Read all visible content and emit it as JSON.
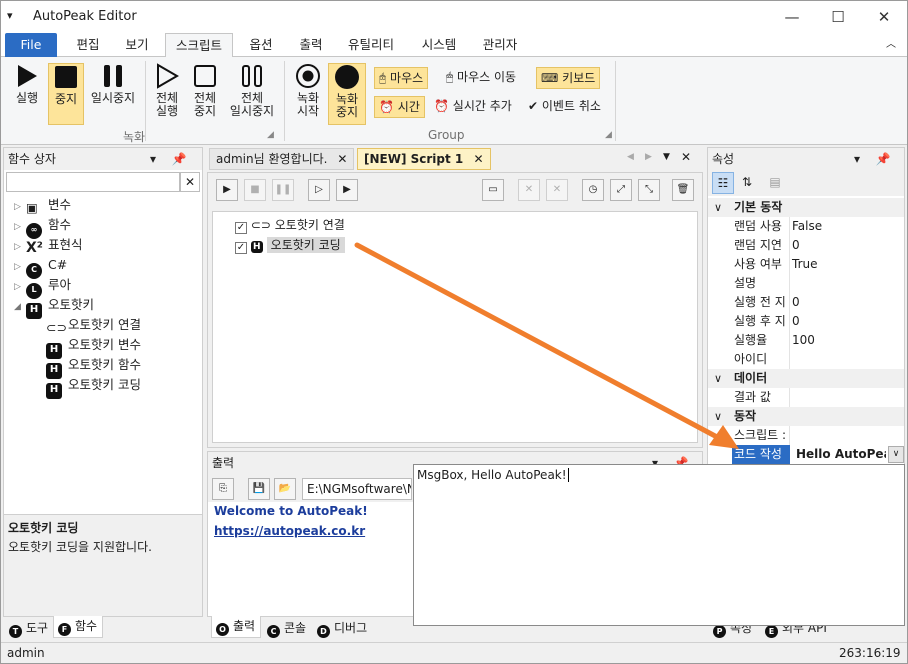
{
  "window": {
    "title": "AutoPeak Editor",
    "app_menu_icon": "menu-icon",
    "minimize": "—",
    "maximize": "☐",
    "close": "✕"
  },
  "ribbon_tabs": [
    "File",
    "편집",
    "보기",
    "스크립트",
    "옵션",
    "출력",
    "유틸리티",
    "시스템",
    "관리자"
  ],
  "ribbon_collapse": "︿",
  "record_group": {
    "label": "녹화",
    "buttons": [
      {
        "label": "실행",
        "icon": "play-icon"
      },
      {
        "label": "중지",
        "icon": "stop-icon",
        "active": true
      },
      {
        "label": "일시중지",
        "icon": "pause-icon"
      }
    ]
  },
  "all_group": {
    "buttons": [
      {
        "label1": "전체",
        "label2": "실행",
        "icon": "play-outline-icon"
      },
      {
        "label1": "전체",
        "label2": "중지",
        "icon": "stop-outline-icon"
      },
      {
        "label1": "전체",
        "label2": "일시중지",
        "icon": "pause-outline-icon"
      }
    ]
  },
  "rec_group": {
    "label": "Group",
    "buttons": [
      {
        "label1": "녹화",
        "label2": "시작",
        "icon": "record-icon"
      },
      {
        "label1": "녹화",
        "label2": "중지",
        "icon": "record-stop-icon",
        "active": true
      }
    ],
    "small_buttons": [
      {
        "label": "마우스",
        "active": true,
        "icon": "mouse-icon"
      },
      {
        "label": "마우스 이동",
        "active": false,
        "icon": "mouse-move-icon"
      },
      {
        "label": "키보드",
        "active": true,
        "icon": "keyboard-icon"
      },
      {
        "label": "시간",
        "active": true,
        "icon": "clock-icon"
      },
      {
        "label": "실시간 추가",
        "active": false,
        "icon": "alarm-add-icon"
      },
      {
        "label": "이벤트 취소",
        "active": false,
        "icon": "check-circle-icon"
      }
    ]
  },
  "function_box": {
    "title": "함수 상자",
    "search_value": "",
    "clear": "✕",
    "tree": [
      {
        "label": "변수",
        "level": 0,
        "expand": "▷",
        "icon": "variable-icon"
      },
      {
        "label": "함수",
        "level": 0,
        "expand": "▷",
        "icon": "function-icon"
      },
      {
        "label": "표현식",
        "level": 0,
        "expand": "▷",
        "icon": "expression-icon"
      },
      {
        "label": "C#",
        "level": 0,
        "expand": "▷",
        "icon": "csharp-icon"
      },
      {
        "label": "루아",
        "level": 0,
        "expand": "▷",
        "icon": "lua-icon"
      },
      {
        "label": "오토핫키",
        "level": 0,
        "expand": "◢",
        "icon": "autohotkey-icon"
      },
      {
        "label": "오토핫키 연결",
        "level": 1,
        "icon": "link-icon"
      },
      {
        "label": "오토핫키 변수",
        "level": 1,
        "icon": "autohotkey-icon"
      },
      {
        "label": "오토핫키 함수",
        "level": 1,
        "icon": "autohotkey-icon"
      },
      {
        "label": "오토핫키 코딩",
        "level": 1,
        "icon": "autohotkey-icon"
      }
    ],
    "desc_title": "오토핫키 코딩",
    "desc_text": "오토핫키 코딩을 지원합니다.",
    "bottom_tabs": [
      {
        "label": "도구",
        "letter": "T"
      },
      {
        "label": "함수",
        "letter": "F"
      }
    ]
  },
  "doc_tabs": [
    {
      "label": "admin님 환영합니다.",
      "close": "✕"
    },
    {
      "label": "[NEW] Script 1",
      "close": "✕"
    }
  ],
  "doc_nav": {
    "prev": "◀",
    "next": "▶",
    "dropdown": "▼",
    "close": "✕"
  },
  "script_tree": [
    {
      "label": "오토핫키 연결",
      "checked": true,
      "icon": "link-icon"
    },
    {
      "label": "오토핫키 코딩",
      "checked": true,
      "icon": "autohotkey-icon",
      "selected": true
    }
  ],
  "output": {
    "title": "출력",
    "path": "E:\\NGMsoftware\\NG",
    "lines": [
      "Welcome to AutoPeak!",
      "https://autopeak.co.kr"
    ],
    "bottom_tabs": [
      {
        "label": "출력",
        "letter": "O"
      },
      {
        "label": "콘솔",
        "letter": "C"
      },
      {
        "label": "디버그",
        "letter": "D"
      }
    ]
  },
  "properties": {
    "title": "속성",
    "categories": [
      {
        "name": "기본 동작",
        "rows": [
          {
            "k": "랜덤 사용",
            "v": "False"
          },
          {
            "k": "랜덤 지연",
            "v": "0"
          },
          {
            "k": "사용 여부",
            "v": "True"
          },
          {
            "k": "설명",
            "v": ""
          },
          {
            "k": "실행 전 지",
            "v": "0"
          },
          {
            "k": "실행 후 지",
            "v": "0"
          },
          {
            "k": "실행율",
            "v": "100"
          },
          {
            "k": "아이디",
            "v": ""
          }
        ]
      },
      {
        "name": "데이터",
        "rows": [
          {
            "k": "결과 값",
            "v": ""
          }
        ]
      },
      {
        "name": "동작",
        "rows": [
          {
            "k": "스크립트 :",
            "v": ""
          },
          {
            "k": "코드 작성",
            "v": "Hello AutoPeak!",
            "selected": true
          }
        ]
      }
    ],
    "bottom_tabs": [
      {
        "label": "속성",
        "letter": "P"
      },
      {
        "label": "외부 API",
        "letter": "E"
      }
    ]
  },
  "code_popup": {
    "text": "MsgBox, Hello AutoPeak!"
  },
  "status": {
    "user": "admin",
    "position": "263:16:19"
  },
  "accent": "#2b6cc4",
  "highlight": "#fde49a",
  "arrow_color": "#f07e2d"
}
